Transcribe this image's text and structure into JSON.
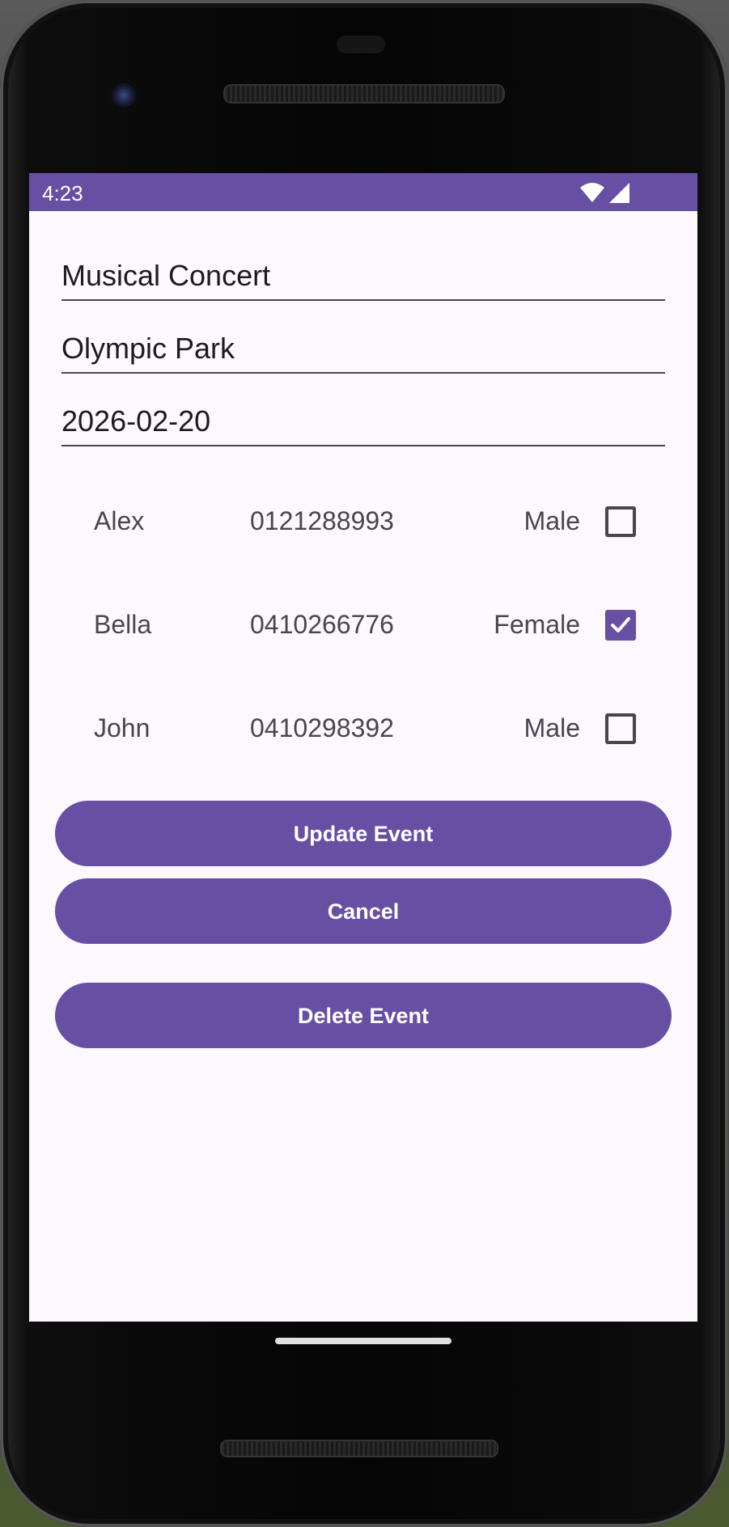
{
  "status_bar": {
    "time": "4:23",
    "wifi_icon": "wifi-icon",
    "signal_icon": "signal-icon",
    "color": "#6750a4"
  },
  "form": {
    "event_name": "Musical Concert",
    "location": "Olympic Park",
    "date": "2026-02-20"
  },
  "attendees": [
    {
      "name": "Alex",
      "phone": "0121288993",
      "gender": "Male",
      "checked": false
    },
    {
      "name": "Bella",
      "phone": "0410266776",
      "gender": "Female",
      "checked": true
    },
    {
      "name": "John",
      "phone": "0410298392",
      "gender": "Male",
      "checked": false
    }
  ],
  "buttons": {
    "update": "Update Event",
    "cancel": "Cancel",
    "delete": "Delete Event"
  },
  "colors": {
    "primary": "#6750a4",
    "background": "#fdf7fe",
    "text": "#1d1b20",
    "secondary_text": "#49454f"
  }
}
